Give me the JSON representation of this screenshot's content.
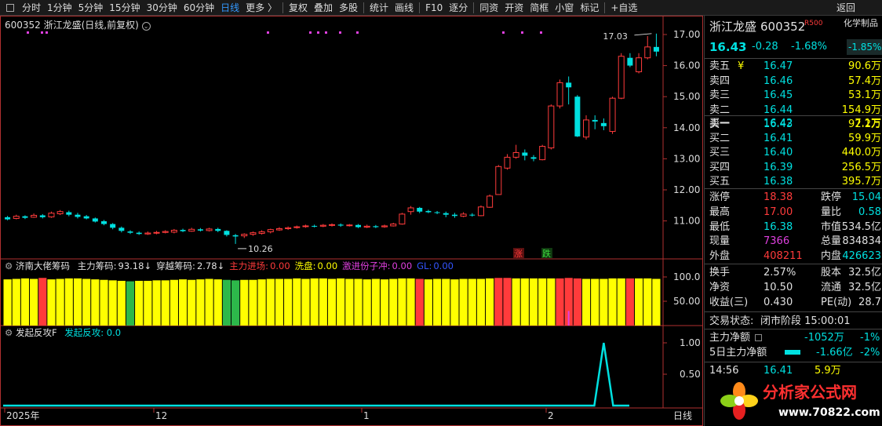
{
  "toolbar": {
    "items": [
      "分时",
      "1分钟",
      "5分钟",
      "15分钟",
      "30分钟",
      "60分钟",
      "日线",
      "更多 〉",
      "复权",
      "叠加",
      "多股",
      "统计",
      "画线",
      "F10",
      "逐分",
      "同资",
      "开资",
      "简框",
      "小窗",
      "标记",
      "+自选",
      "返回"
    ],
    "selected": "日线"
  },
  "chart": {
    "title": "600352 浙江龙盛(日线,前复权)",
    "peak_label": "17.03",
    "low_label": "10.26",
    "signal_up": "涨",
    "signal_down": "跌",
    "y_ticks": [
      "17.00",
      "16.00",
      "15.00",
      "14.00",
      "13.00",
      "12.00",
      "11.00"
    ],
    "x_ticks": [
      "2025年",
      "12",
      "1",
      "2"
    ],
    "period": "日线",
    "colors": {
      "up": "#ff3b3b",
      "down": "#00e0e0",
      "yellow": "#ffff00",
      "green": "#2db84a",
      "magenta": "#e040e0"
    },
    "candles": [
      [
        11.12,
        11.05,
        11.16,
        11.02
      ],
      [
        11.08,
        11.15,
        11.2,
        11.05
      ],
      [
        11.15,
        11.1,
        11.18,
        11.06
      ],
      [
        11.12,
        11.18,
        11.24,
        11.1
      ],
      [
        11.18,
        11.12,
        11.22,
        11.08
      ],
      [
        11.13,
        11.25,
        11.3,
        11.1
      ],
      [
        11.23,
        11.3,
        11.35,
        11.19
      ],
      [
        11.28,
        11.2,
        11.33,
        11.15
      ],
      [
        11.2,
        11.13,
        11.26,
        11.08
      ],
      [
        11.15,
        11.08,
        11.19,
        11.05
      ],
      [
        11.08,
        10.98,
        11.11,
        10.95
      ],
      [
        10.99,
        10.9,
        11.03,
        10.86
      ],
      [
        10.9,
        10.78,
        10.93,
        10.73
      ],
      [
        10.78,
        10.68,
        10.82,
        10.63
      ],
      [
        10.66,
        10.62,
        10.7,
        10.58
      ],
      [
        10.62,
        10.58,
        10.66,
        10.55
      ],
      [
        10.58,
        10.61,
        10.66,
        10.55
      ],
      [
        10.61,
        10.63,
        10.68,
        10.57
      ],
      [
        10.63,
        10.66,
        10.7,
        10.6
      ],
      [
        10.64,
        10.7,
        10.74,
        10.6
      ],
      [
        10.71,
        10.67,
        10.75,
        10.64
      ],
      [
        10.67,
        10.73,
        10.78,
        10.65
      ],
      [
        10.73,
        10.69,
        10.77,
        10.66
      ],
      [
        10.69,
        10.74,
        10.78,
        10.66
      ],
      [
        10.74,
        10.68,
        10.78,
        10.64
      ],
      [
        10.68,
        10.55,
        10.7,
        10.5
      ],
      [
        10.54,
        10.5,
        10.58,
        10.26
      ],
      [
        10.52,
        10.57,
        10.6,
        10.45
      ],
      [
        10.57,
        10.62,
        10.66,
        10.52
      ],
      [
        10.6,
        10.65,
        10.7,
        10.56
      ],
      [
        10.65,
        10.72,
        10.75,
        10.6
      ],
      [
        10.71,
        10.75,
        10.8,
        10.68
      ],
      [
        10.75,
        10.78,
        10.82,
        10.71
      ],
      [
        10.79,
        10.81,
        10.85,
        10.75
      ],
      [
        10.82,
        10.84,
        10.88,
        10.78
      ],
      [
        10.84,
        10.83,
        10.88,
        10.79
      ],
      [
        10.83,
        10.86,
        10.9,
        10.8
      ],
      [
        10.86,
        10.88,
        10.92,
        10.82
      ],
      [
        10.88,
        10.85,
        10.92,
        10.81
      ],
      [
        10.85,
        10.87,
        10.9,
        10.82
      ],
      [
        10.87,
        10.8,
        10.9,
        10.77
      ],
      [
        10.8,
        10.83,
        10.88,
        10.77
      ],
      [
        10.83,
        10.8,
        10.87,
        10.77
      ],
      [
        10.81,
        10.84,
        10.88,
        10.78
      ],
      [
        10.84,
        10.9,
        10.94,
        10.82
      ],
      [
        10.9,
        11.22,
        11.26,
        10.88
      ],
      [
        11.3,
        11.42,
        11.48,
        11.2
      ],
      [
        11.42,
        11.3,
        11.45,
        11.25
      ],
      [
        11.32,
        11.28,
        11.36,
        11.25
      ],
      [
        11.28,
        11.26,
        11.32,
        11.22
      ],
      [
        11.25,
        11.2,
        11.3,
        11.12
      ],
      [
        11.2,
        11.16,
        11.26,
        11.1
      ],
      [
        11.15,
        11.22,
        11.28,
        11.12
      ],
      [
        11.2,
        11.18,
        11.25,
        11.14
      ],
      [
        11.17,
        11.45,
        11.5,
        11.15
      ],
      [
        11.44,
        11.8,
        11.85,
        11.42
      ],
      [
        11.85,
        12.75,
        12.8,
        11.85
      ],
      [
        12.7,
        13.05,
        13.15,
        12.65
      ],
      [
        13.05,
        13.2,
        13.45,
        13.0
      ],
      [
        13.2,
        13.1,
        13.3,
        12.95
      ],
      [
        13.05,
        13.0,
        13.12,
        12.92
      ],
      [
        12.97,
        13.4,
        13.45,
        12.95
      ],
      [
        13.35,
        14.7,
        14.75,
        13.3
      ],
      [
        14.7,
        15.45,
        15.55,
        14.62
      ],
      [
        15.45,
        15.3,
        15.65,
        14.75
      ],
      [
        15.0,
        13.72,
        15.05,
        13.7
      ],
      [
        13.7,
        14.25,
        14.4,
        13.62
      ],
      [
        14.25,
        14.2,
        14.4,
        13.95
      ],
      [
        14.15,
        14.05,
        14.3,
        13.92
      ],
      [
        13.88,
        14.95,
        15.0,
        13.8
      ],
      [
        14.95,
        16.3,
        16.4,
        14.92
      ],
      [
        16.25,
        16.0,
        16.4,
        15.95
      ],
      [
        15.8,
        16.25,
        16.4,
        15.75
      ],
      [
        16.25,
        16.6,
        16.95,
        16.2
      ],
      [
        16.6,
        16.45,
        17.03,
        16.3
      ]
    ],
    "mid_panel": {
      "name": "济南大佬筹码",
      "items": [
        {
          "label": "主力筹码:",
          "value": "93.18↓"
        },
        {
          "label": "穿越筹码:",
          "value": "2.78↓"
        },
        {
          "label": "主力进场:",
          "value": "0.00"
        },
        {
          "label": "洗盘:",
          "value": "0.00"
        },
        {
          "label": "激进份子冲:",
          "value": "0.00"
        },
        {
          "label": "GL:",
          "value": "0.00"
        }
      ],
      "y_ticks": [
        "100.0",
        "50.00"
      ],
      "bar_values": [
        95,
        96,
        97,
        96,
        98,
        95,
        96,
        97,
        97,
        96,
        95,
        94,
        93,
        92,
        91,
        92,
        92,
        93,
        93,
        94,
        95,
        94,
        95,
        96,
        95,
        94,
        93,
        94,
        94,
        95,
        96,
        96,
        96,
        97,
        96,
        97,
        97,
        96,
        97,
        96,
        96,
        95,
        96,
        95,
        96,
        97,
        97,
        96,
        95,
        96,
        96,
        95,
        96,
        96,
        96,
        97,
        98,
        98,
        97,
        97,
        97,
        97,
        97,
        97,
        98,
        97,
        96,
        96,
        96,
        97,
        97,
        97,
        97,
        97,
        96
      ],
      "bar_colors": [
        "Y",
        "Y",
        "Y",
        "Y",
        "R",
        "Y",
        "Y",
        "Y",
        "Y",
        "Y",
        "Y",
        "Y",
        "Y",
        "Y",
        "G",
        "Y",
        "Y",
        "Y",
        "Y",
        "Y",
        "Y",
        "Y",
        "Y",
        "Y",
        "Y",
        "G",
        "G",
        "Y",
        "Y",
        "Y",
        "Y",
        "Y",
        "Y",
        "Y",
        "Y",
        "Y",
        "Y",
        "Y",
        "Y",
        "Y",
        "Y",
        "Y",
        "Y",
        "Y",
        "Y",
        "Y",
        "Y",
        "R",
        "Y",
        "Y",
        "Y",
        "Y",
        "Y",
        "Y",
        "Y",
        "Y",
        "R",
        "R",
        "Y",
        "Y",
        "Y",
        "Y",
        "Y",
        "R",
        "R",
        "R",
        "Y",
        "Y",
        "Y",
        "Y",
        "Y",
        "R",
        "Y",
        "Y",
        "Y"
      ],
      "magenta_value": 30
    },
    "bottom_panel": {
      "name": "发起反攻F",
      "label": "发起反攻:",
      "value": "0.0",
      "y_ticks": [
        "1.00",
        "0.50"
      ],
      "spike_index": 68
    }
  },
  "quote": {
    "name": "浙江龙盛",
    "code": "600352",
    "tag": "R500",
    "sector": "化学制品",
    "sector_change": "-1.85%",
    "price": "16.43",
    "change": "-0.28",
    "change_pct": "-1.68%",
    "asks": [
      {
        "label": "卖五",
        "mark": "¥",
        "price": "16.47",
        "vol": "90.6万"
      },
      {
        "label": "卖四",
        "mark": "",
        "price": "16.46",
        "vol": "57.4万"
      },
      {
        "label": "卖三",
        "mark": "",
        "price": "16.45",
        "vol": "53.1万"
      },
      {
        "label": "卖二",
        "mark": "",
        "price": "16.44",
        "vol": "154.9万"
      },
      {
        "label": "卖一",
        "mark": "",
        "price": "16.43",
        "vol": "92.2万"
      }
    ],
    "bids": [
      {
        "label": "买一",
        "price": "16.42",
        "vol": "7.1万"
      },
      {
        "label": "买二",
        "price": "16.41",
        "vol": "59.9万"
      },
      {
        "label": "买三",
        "price": "16.40",
        "vol": "440.0万"
      },
      {
        "label": "买四",
        "price": "16.39",
        "vol": "256.5万"
      },
      {
        "label": "买五",
        "price": "16.38",
        "vol": "395.7万"
      }
    ],
    "stats": [
      {
        "l1": "涨停",
        "v1": "18.38",
        "c1": "red",
        "l2": "跌停",
        "v2": "15.04",
        "c2": "green"
      },
      {
        "l1": "最高",
        "v1": "17.00",
        "c1": "red",
        "l2": "量比",
        "v2": "0.58",
        "c2": "green"
      },
      {
        "l1": "最低",
        "v1": "16.38",
        "c1": "green",
        "l2": "市值",
        "v2": "534.5亿",
        "c2": "white"
      },
      {
        "l1": "现量",
        "v1": "7366",
        "c1": "mag",
        "l2": "总量",
        "v2": "834834",
        "c2": "white"
      },
      {
        "l1": "外盘",
        "v1": "408211",
        "c1": "red",
        "l2": "内盘",
        "v2": "426623",
        "c2": "green"
      }
    ],
    "stats2": [
      {
        "l1": "换手",
        "v1": "2.57%",
        "l2": "股本",
        "v2": "32.5亿"
      },
      {
        "l1": "净资",
        "v1": "10.50",
        "l2": "流通",
        "v2": "32.5亿"
      },
      {
        "l1": "收益(三)",
        "v1": "0.430",
        "l2": "PE(动)",
        "v2": "28.7"
      }
    ],
    "status_label": "交易状态:",
    "status_value": "闭市阶段 15:00:01",
    "flow1_label": "主力净额",
    "flow1_value": "-1052万",
    "flow1_pct": "-1%",
    "flow2_label": "5日主力净额",
    "flow2_value": "-1.66亿",
    "flow2_pct": "-2%",
    "ticks": [
      {
        "time": "14:56",
        "price": "16.41",
        "vol": "5.9万"
      }
    ]
  },
  "logo": {
    "name": "分析家公式网",
    "url": "www.70822.com"
  }
}
